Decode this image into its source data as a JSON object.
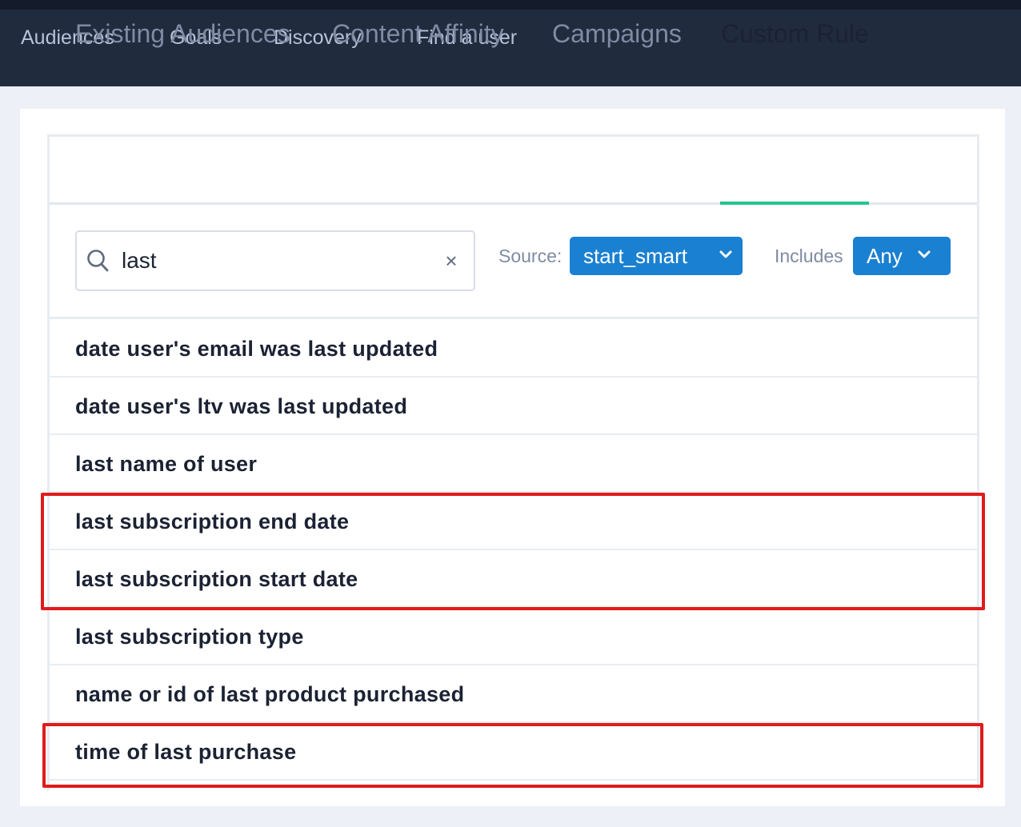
{
  "nav": {
    "items": [
      {
        "label": "Audiences"
      },
      {
        "label": "Goals"
      },
      {
        "label": "Discovery"
      },
      {
        "label": "Find a user"
      }
    ]
  },
  "tabs": [
    {
      "label": "Existing Audiences",
      "active": false
    },
    {
      "label": "Content Affinity",
      "active": false
    },
    {
      "label": "Campaigns",
      "active": false
    },
    {
      "label": "Custom Rule",
      "active": true
    }
  ],
  "search": {
    "value": "last",
    "clear_icon": "close-icon",
    "search_icon": "search-icon"
  },
  "filters": {
    "source_label": "Source:",
    "source_value": "start_smart",
    "includes_label": "Includes",
    "includes_value": "Any"
  },
  "results": [
    {
      "label": "date user's email was last updated",
      "highlighted": false
    },
    {
      "label": "date user's ltv was last updated",
      "highlighted": false
    },
    {
      "label": "last name of user",
      "highlighted": false
    },
    {
      "label": "last subscription end date",
      "highlighted": true
    },
    {
      "label": "last subscription start date",
      "highlighted": true
    },
    {
      "label": "last subscription type",
      "highlighted": false
    },
    {
      "label": "name or id of last product purchased",
      "highlighted": false
    },
    {
      "label": "time of last purchase",
      "highlighted": true
    }
  ],
  "colors": {
    "nav_bg": "#212b3e",
    "accent_blue": "#1a80d1",
    "tab_underline": "#23c48e",
    "highlight_red": "#e01b1b"
  }
}
